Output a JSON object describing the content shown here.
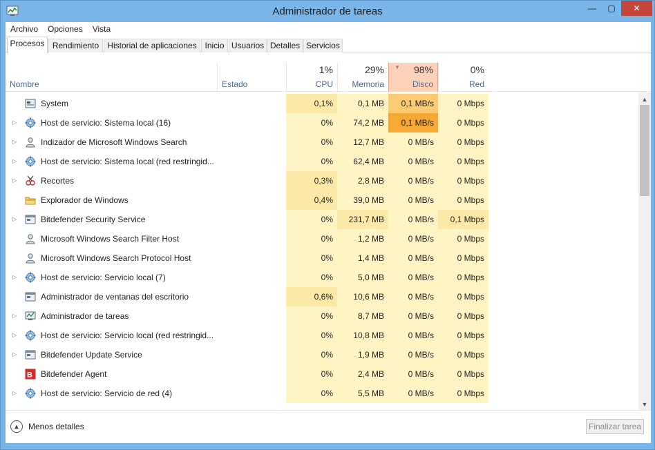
{
  "window": {
    "title": "Administrador de tareas",
    "controls": {
      "minimize": "—",
      "maximize": "▢",
      "close": "✕"
    }
  },
  "menu": [
    "Archivo",
    "Opciones",
    "Vista"
  ],
  "tabs": [
    "Procesos",
    "Rendimiento",
    "Historial de aplicaciones",
    "Inicio",
    "Usuarios",
    "Detalles",
    "Servicios"
  ],
  "active_tab": "Procesos",
  "columns": {
    "nombre": "Nombre",
    "estado": "Estado",
    "cpu": {
      "pct": "1%",
      "label": "CPU"
    },
    "memoria": {
      "pct": "29%",
      "label": "Memoria"
    },
    "disco": {
      "pct": "98%",
      "label": "Disco"
    },
    "red": {
      "pct": "0%",
      "label": "Red"
    }
  },
  "colors": {
    "light": "#fff4c4",
    "mid": "#fde9a8",
    "strong": "#fbd97a",
    "disk_hot": "#f7a935",
    "disk_warm": "#fcca72"
  },
  "processes": [
    {
      "name": "System",
      "expand": false,
      "icon": "system-icon",
      "cpu": "0,1%",
      "mem": "0,1 MB",
      "disk": "0,1 MB/s",
      "net": "0 Mbps",
      "h": [
        "mid",
        "light",
        "warm",
        "light"
      ]
    },
    {
      "name": "Host de servicio: Sistema local (16)",
      "expand": true,
      "icon": "gear-icon",
      "cpu": "0%",
      "mem": "74,2 MB",
      "disk": "0,1 MB/s",
      "net": "0 Mbps",
      "h": [
        "light",
        "light",
        "hot",
        "light"
      ]
    },
    {
      "name": "Indizador de Microsoft Windows Search",
      "expand": true,
      "icon": "search-user-icon",
      "cpu": "0%",
      "mem": "12,7 MB",
      "disk": "0 MB/s",
      "net": "0 Mbps",
      "h": [
        "light",
        "light",
        "light",
        "light"
      ]
    },
    {
      "name": "Host de servicio: Sistema local (red restringid...",
      "expand": true,
      "icon": "gear-icon",
      "cpu": "0%",
      "mem": "62,4 MB",
      "disk": "0 MB/s",
      "net": "0 Mbps",
      "h": [
        "light",
        "light",
        "light",
        "light"
      ]
    },
    {
      "name": "Recortes",
      "expand": true,
      "icon": "scissors-icon",
      "cpu": "0,3%",
      "mem": "2,8 MB",
      "disk": "0 MB/s",
      "net": "0 Mbps",
      "h": [
        "mid",
        "light",
        "light",
        "light"
      ]
    },
    {
      "name": "Explorador de Windows",
      "expand": false,
      "icon": "folder-icon",
      "cpu": "0,4%",
      "mem": "39,0 MB",
      "disk": "0 MB/s",
      "net": "0 Mbps",
      "h": [
        "mid",
        "light",
        "light",
        "light"
      ]
    },
    {
      "name": "Bitdefender Security Service",
      "expand": true,
      "icon": "window-icon",
      "cpu": "0%",
      "mem": "231,7 MB",
      "disk": "0 MB/s",
      "net": "0,1 Mbps",
      "h": [
        "light",
        "mid",
        "light",
        "mid"
      ]
    },
    {
      "name": "Microsoft Windows Search Filter Host",
      "expand": false,
      "icon": "search-user-icon",
      "cpu": "0%",
      "mem": "1,2 MB",
      "disk": "0 MB/s",
      "net": "0 Mbps",
      "h": [
        "light",
        "light",
        "light",
        "light"
      ]
    },
    {
      "name": "Microsoft Windows Search Protocol Host",
      "expand": false,
      "icon": "search-user-icon",
      "cpu": "0%",
      "mem": "1,4 MB",
      "disk": "0 MB/s",
      "net": "0 Mbps",
      "h": [
        "light",
        "light",
        "light",
        "light"
      ]
    },
    {
      "name": "Host de servicio: Servicio local (7)",
      "expand": true,
      "icon": "gear-icon",
      "cpu": "0%",
      "mem": "5,0 MB",
      "disk": "0 MB/s",
      "net": "0 Mbps",
      "h": [
        "light",
        "light",
        "light",
        "light"
      ]
    },
    {
      "name": "Administrador de ventanas del escritorio",
      "expand": false,
      "icon": "window-icon",
      "cpu": "0,6%",
      "mem": "10,6 MB",
      "disk": "0 MB/s",
      "net": "0 Mbps",
      "h": [
        "mid",
        "light",
        "light",
        "light"
      ]
    },
    {
      "name": "Administrador de tareas",
      "expand": true,
      "icon": "taskmgr-icon",
      "cpu": "0%",
      "mem": "8,7 MB",
      "disk": "0 MB/s",
      "net": "0 Mbps",
      "h": [
        "light",
        "light",
        "light",
        "light"
      ]
    },
    {
      "name": "Host de servicio: Servicio local (red restringid...",
      "expand": true,
      "icon": "gear-icon",
      "cpu": "0%",
      "mem": "10,8 MB",
      "disk": "0 MB/s",
      "net": "0 Mbps",
      "h": [
        "light",
        "light",
        "light",
        "light"
      ]
    },
    {
      "name": "Bitdefender Update Service",
      "expand": true,
      "icon": "window-icon",
      "cpu": "0%",
      "mem": "1,9 MB",
      "disk": "0 MB/s",
      "net": "0 Mbps",
      "h": [
        "light",
        "light",
        "light",
        "light"
      ]
    },
    {
      "name": "Bitdefender Agent",
      "expand": false,
      "icon": "bitdefender-icon",
      "cpu": "0%",
      "mem": "2,4 MB",
      "disk": "0 MB/s",
      "net": "0 Mbps",
      "h": [
        "light",
        "light",
        "light",
        "light"
      ]
    },
    {
      "name": "Host de servicio: Servicio de red (4)",
      "expand": true,
      "icon": "gear-icon",
      "cpu": "0%",
      "mem": "5,5 MB",
      "disk": "0 MB/s",
      "net": "0 Mbps",
      "h": [
        "light",
        "light",
        "light",
        "light"
      ]
    }
  ],
  "footer": {
    "less_details": "Menos detalles",
    "end_task": "Finalizar tarea"
  }
}
